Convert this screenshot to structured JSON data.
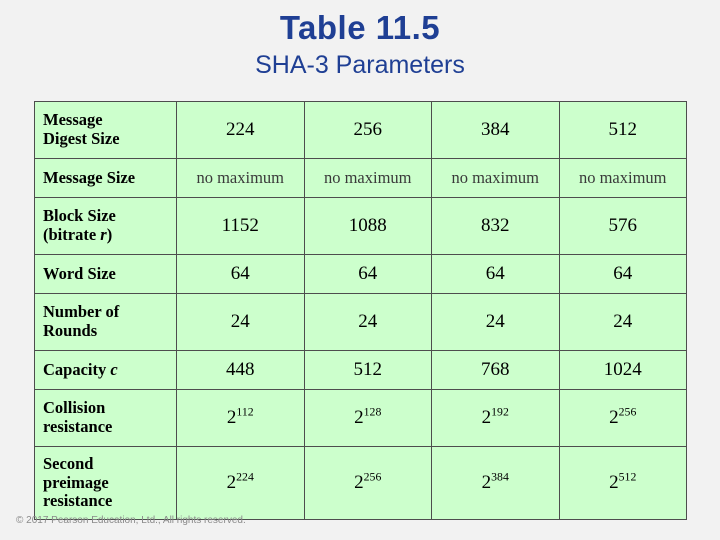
{
  "slide": {
    "title": "Table 11.5",
    "subtitle": "SHA-3 Parameters",
    "copyright": "© 2017 Pearson Education, Ltd., All rights reserved."
  },
  "table": {
    "rows": [
      {
        "label": "Message Digest Size",
        "label_line1": "Message",
        "label_line2": "Digest Size",
        "values": [
          "224",
          "256",
          "384",
          "512"
        ],
        "style": "normal"
      },
      {
        "label": "Message Size",
        "label_line1": "Message Size",
        "label_line2": "",
        "values": [
          "no maximum",
          "no maximum",
          "no maximum",
          "no maximum"
        ],
        "style": "small"
      },
      {
        "label": "Block Size (bitrate r)",
        "label_line1": "Block Size",
        "label_line2": "(bitrate r)",
        "values": [
          "1152",
          "1088",
          "832",
          "576"
        ],
        "style": "normal"
      },
      {
        "label": "Word Size",
        "label_line1": "Word Size",
        "label_line2": "",
        "values": [
          "64",
          "64",
          "64",
          "64"
        ],
        "style": "normal"
      },
      {
        "label": "Number of Rounds",
        "label_line1": "Number of",
        "label_line2": "Rounds",
        "values": [
          "24",
          "24",
          "24",
          "24"
        ],
        "style": "normal"
      },
      {
        "label": "Capacity c",
        "label_line1": "Capacity c",
        "label_line2": "",
        "values": [
          "448",
          "512",
          "768",
          "1024"
        ],
        "style": "normal"
      },
      {
        "label": "Collision resistance",
        "label_line1": "Collision",
        "label_line2": "resistance",
        "values": [
          "2^112",
          "2^128",
          "2^192",
          "2^256"
        ],
        "bases": [
          "2",
          "2",
          "2",
          "2"
        ],
        "exponents": [
          "112",
          "128",
          "192",
          "256"
        ],
        "style": "power"
      },
      {
        "label": "Second preimage resistance",
        "label_line1": "Second",
        "label_line2": "preimage",
        "label_line3": "resistance",
        "values": [
          "2^224",
          "2^256",
          "2^384",
          "2^512"
        ],
        "bases": [
          "2",
          "2",
          "2",
          "2"
        ],
        "exponents": [
          "224",
          "256",
          "384",
          "512"
        ],
        "style": "power"
      }
    ]
  },
  "colors": {
    "title_blue": "#1f3f94",
    "cell_green": "#ccffcc",
    "background": "#f2f2f2",
    "border": "#4d4d4d"
  }
}
